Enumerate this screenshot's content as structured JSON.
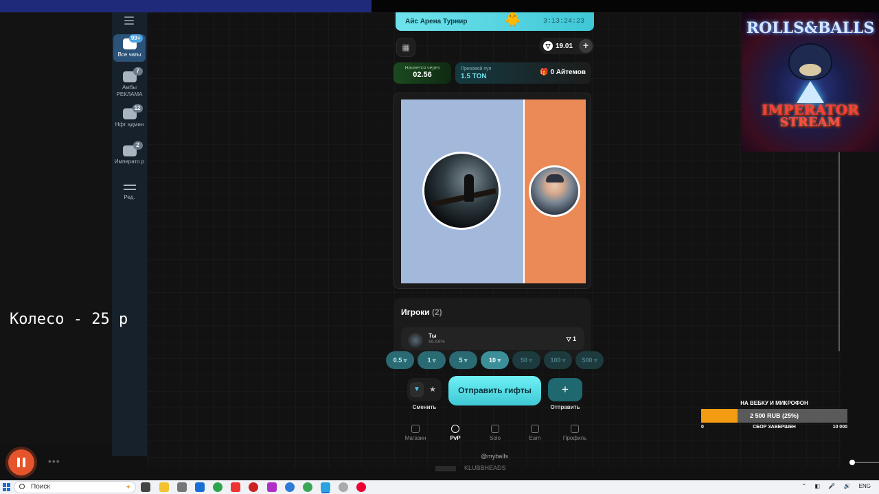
{
  "telegram_sidebar": {
    "items": [
      {
        "label": "Все чаты",
        "badge": "99+",
        "active": true
      },
      {
        "label": "Амбы РЕКЛАМА",
        "badge": "7",
        "active": false
      },
      {
        "label": "Нфт админ",
        "badge": "12",
        "active": false
      },
      {
        "label": "Императо р",
        "badge": "2",
        "active": false
      },
      {
        "label": "Ред.",
        "badge": "",
        "active": false
      }
    ]
  },
  "app": {
    "banner": {
      "title": "Айс Арена Турнир",
      "timer": "3:13:24:23"
    },
    "balance": "19.01",
    "start": {
      "label": "Начнется через",
      "value": "02.56"
    },
    "prize": {
      "label": "Призовой пул",
      "value": "1.5 TON",
      "items": "0 Айтемов"
    },
    "players": {
      "title": "Игроки",
      "count": "(2)",
      "list": [
        {
          "name": "Ты",
          "percent": "66.66%",
          "value": "1"
        }
      ]
    },
    "bets": [
      {
        "label": "0.5",
        "state": "normal"
      },
      {
        "label": "1",
        "state": "normal"
      },
      {
        "label": "5",
        "state": "normal"
      },
      {
        "label": "10",
        "state": "selected"
      },
      {
        "label": "50",
        "state": "dim"
      },
      {
        "label": "100",
        "state": "dim"
      },
      {
        "label": "500",
        "state": "dim"
      }
    ],
    "switch_label": "Сменить",
    "send_gifts_label": "Отправить гифты",
    "send_label": "Отправить",
    "nav": [
      {
        "label": "Магазин",
        "active": false
      },
      {
        "label": "PvP",
        "active": true
      },
      {
        "label": "Solo",
        "active": false
      },
      {
        "label": "Earn",
        "active": false
      },
      {
        "label": "Профиль",
        "active": false
      }
    ],
    "handle": "@myballs"
  },
  "overlay": {
    "wheel_text": "Колесо - 25 р",
    "logo": {
      "line1": "ROLLS&BALLS",
      "line2": "IMPERATOR",
      "line3": "STREAM"
    },
    "goal": {
      "title": "НА ВЕБКУ И МИКРОФОН",
      "value": "2 500 RUB (25%)",
      "progress": 0.25,
      "min": "0",
      "status": "СБОР ЗАВЕРШЕН",
      "max": "10 000"
    },
    "under_text": "KLUBBHEADS"
  },
  "taskbar": {
    "search_placeholder": "Поиск",
    "lang": "ENG"
  },
  "colors": {
    "accent": "#4fe3ec",
    "blue_segment": "#a3b9dc",
    "orange_segment": "#eb8a57",
    "goal_fill": "#f39c12"
  }
}
